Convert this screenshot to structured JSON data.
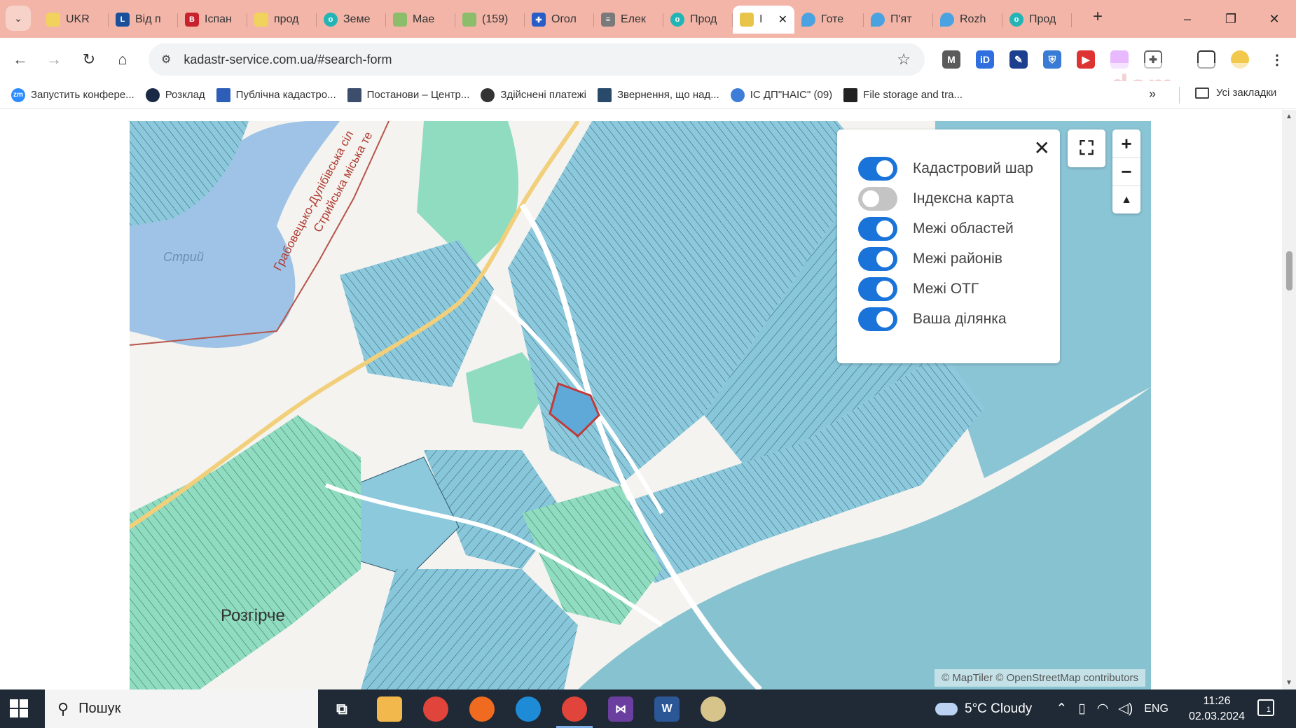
{
  "browser": {
    "tabs": [
      {
        "label": "UKR",
        "icon": "site-favicon"
      },
      {
        "label": "Від п",
        "icon": "liga-favicon"
      },
      {
        "label": "Іспан",
        "icon": "b-favicon"
      },
      {
        "label": "прод",
        "icon": "site-favicon"
      },
      {
        "label": "Земе",
        "icon": "olx-favicon"
      },
      {
        "label": "Мае",
        "icon": "image-favicon"
      },
      {
        "label": "(159)",
        "icon": "image-favicon"
      },
      {
        "label": "Огол",
        "icon": "shield-favicon"
      },
      {
        "label": "Елек",
        "icon": "document-favicon"
      },
      {
        "label": "Прод",
        "icon": "olx-favicon"
      },
      {
        "label": "І",
        "icon": "kadastr-favicon",
        "active": true
      },
      {
        "label": "Готе",
        "icon": "maps-pin-favicon"
      },
      {
        "label": "П'ят",
        "icon": "maps-pin-favicon"
      },
      {
        "label": "Rozh",
        "icon": "maps-pin-favicon"
      },
      {
        "label": "Прод",
        "icon": "olx-favicon"
      }
    ],
    "new_tab": "+",
    "window_controls": {
      "minimize": "–",
      "restore": "❐",
      "close": "✕"
    },
    "url": "kadastr-service.com.ua/#search-form",
    "bookmarks": [
      "Запустить конфере...",
      "Розклад",
      "Публічна кадастро...",
      "Постанови – Центр...",
      "Здійснені платежі",
      "Звернення, що над...",
      "ІС ДП\"НАІС\" (09)",
      "File storage and tra..."
    ],
    "bookmarks_more": "»",
    "all_bookmarks": "Усі закладки",
    "watermark": "dom"
  },
  "map": {
    "layer_panel": {
      "close": "✕",
      "layers": [
        {
          "label": "Кадастровий шар",
          "on": true
        },
        {
          "label": "Індексна карта",
          "on": false
        },
        {
          "label": "Межі областей",
          "on": true
        },
        {
          "label": "Межі районів",
          "on": true
        },
        {
          "label": "Межі ОТГ",
          "on": true
        },
        {
          "label": "Ваша ділянка",
          "on": true
        }
      ]
    },
    "controls": {
      "zoom_in": "+",
      "zoom_out": "−",
      "compass": "▲"
    },
    "labels": {
      "river": "Стрий",
      "boundary_1": "Грабовецько-Дулібівська сіл",
      "boundary_2": "Стрийська міська те",
      "village": "Розгірче"
    },
    "attribution": "© MapTiler  © OpenStreetMap contributors",
    "colors": {
      "parcel": "#8cc9dc",
      "parcel_dark": "#7bb7cf",
      "green_parcel": "#8fdcc0",
      "water": "#9ec3e6",
      "highlight": "#c03a3a",
      "toggle_on": "#1a73d9"
    }
  },
  "taskbar": {
    "search_placeholder": "Пошук",
    "weather": "5°C  Cloudy",
    "language": "ENG",
    "time": "11:26",
    "date": "02.03.2024",
    "notifications": "1"
  }
}
